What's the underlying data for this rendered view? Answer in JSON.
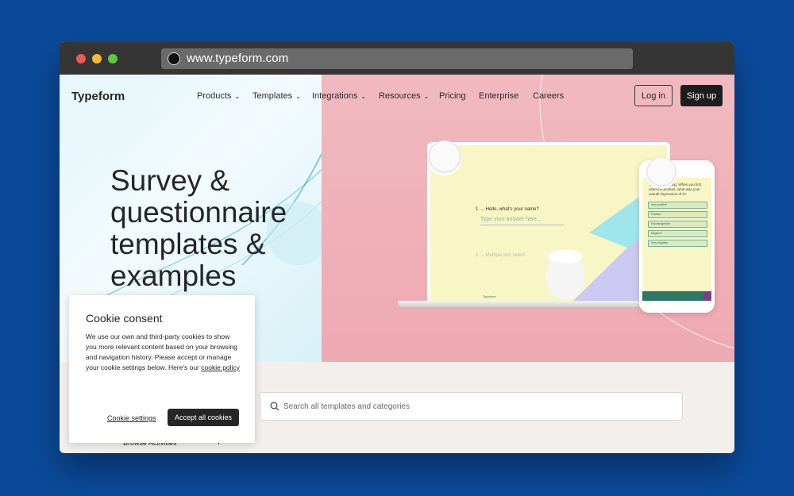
{
  "browser": {
    "url": "www.typeform.com"
  },
  "header": {
    "brand": "Typeform",
    "nav": [
      {
        "label": "Products",
        "dropdown": true
      },
      {
        "label": "Templates",
        "dropdown": true
      },
      {
        "label": "Integrations",
        "dropdown": true
      },
      {
        "label": "Resources",
        "dropdown": true
      },
      {
        "label": "Pricing",
        "dropdown": false
      },
      {
        "label": "Enterprise",
        "dropdown": false
      },
      {
        "label": "Careers",
        "dropdown": false
      }
    ],
    "login_label": "Log in",
    "signup_label": "Sign up"
  },
  "hero": {
    "headline_lines": [
      "Survey &",
      "questionnaire",
      "templates &",
      "examples"
    ]
  },
  "mockup": {
    "laptop_question": "1 → Hello, what's your name?",
    "laptop_answer_placeholder": "Type your answer here...",
    "laptop_question_2": "2 → Multiple text select",
    "laptop_logo": "Typeform",
    "phone_question": "→ Let's get going. When you first used the product, what was your overall impression of it?",
    "phone_options": [
      "Very positive",
      "Positive",
      "Knowledgeable",
      "Negative",
      "Very negative"
    ]
  },
  "cookie": {
    "title": "Cookie consent",
    "body": "We use our own and third-party cookies to show you more relevant content based on your browsing and navigation history. Please accept or manage your cookie settings below. Here's our",
    "link_label": "cookie policy",
    "settings_label": "Cookie settings",
    "accept_label": "Accept all cookies"
  },
  "search": {
    "placeholder": "Search all templates and categories"
  },
  "browse": {
    "label": "Browse Activities",
    "toggle": "+"
  },
  "colors": {
    "background": "#0b4a99",
    "titlebar": "#353535",
    "hero_pink": "#f1b9c0",
    "hero_blue": "#e2f6fb",
    "dark_button": "#1d1d1d",
    "lower_section": "#f2efec"
  }
}
